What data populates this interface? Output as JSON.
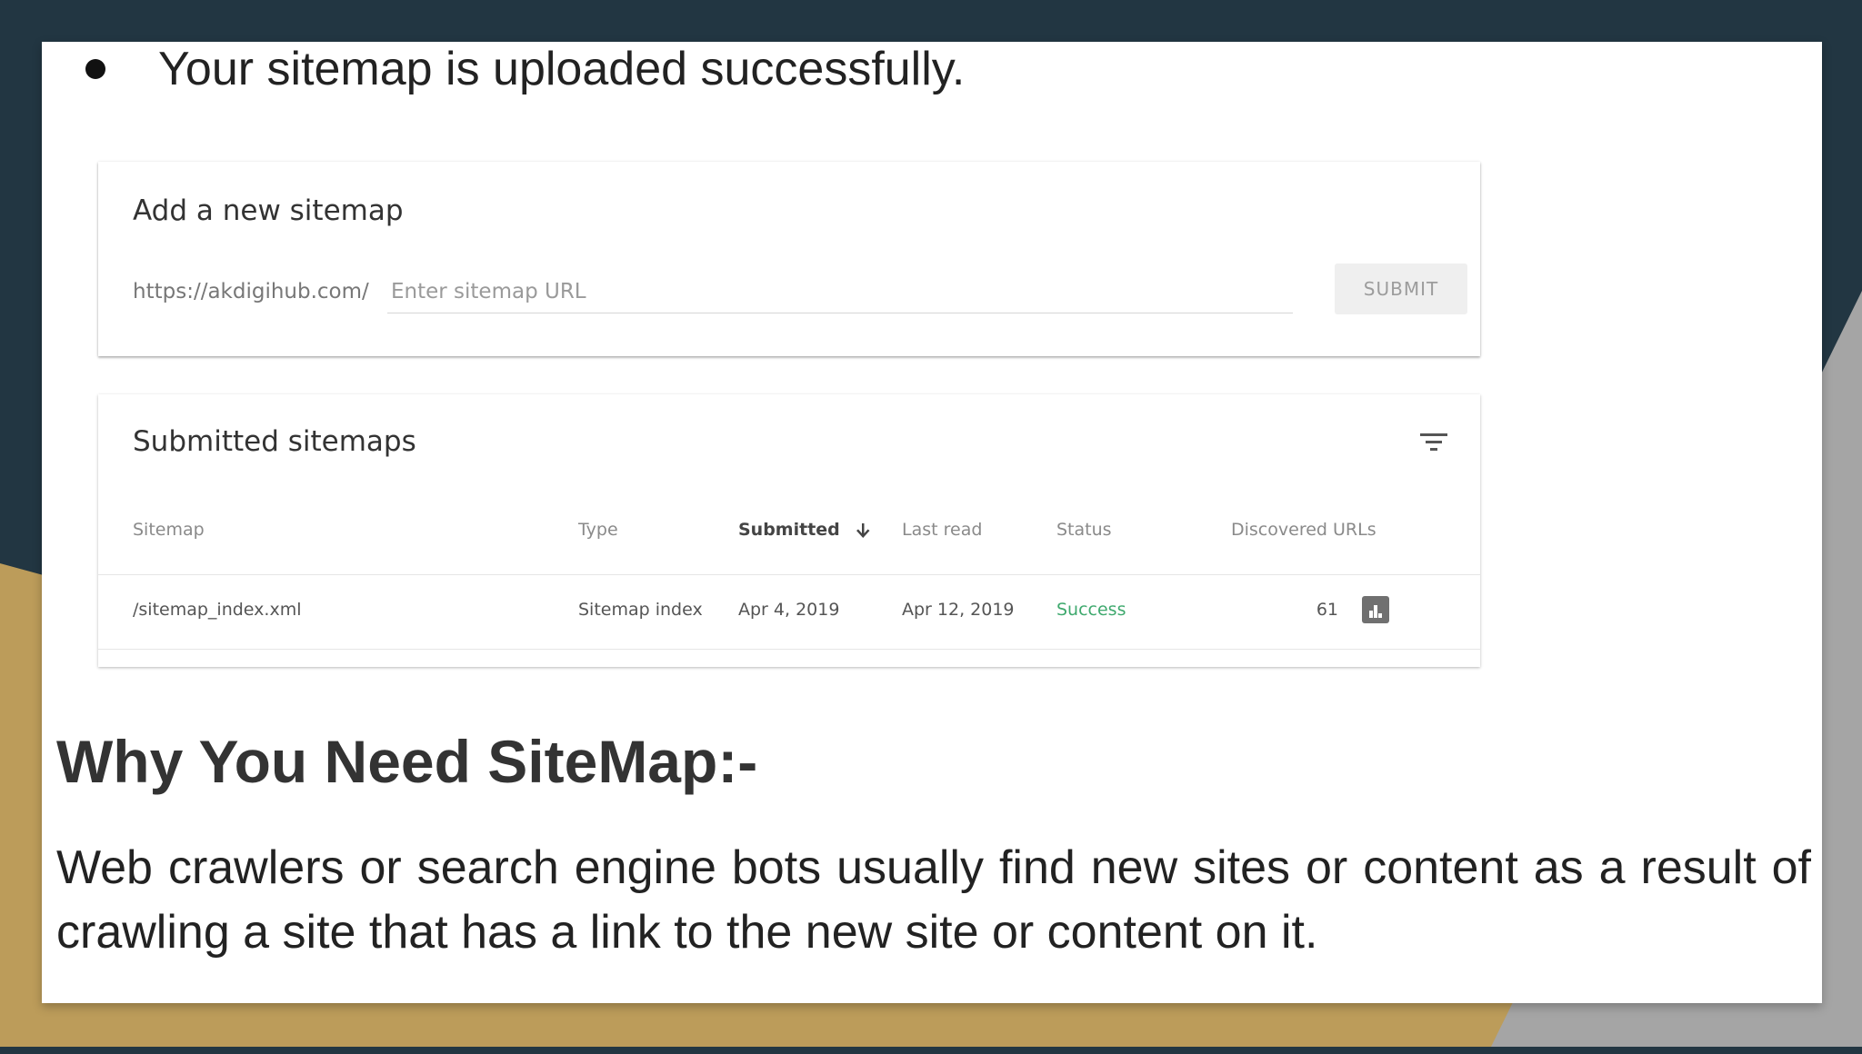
{
  "bullet": {
    "text": "Your sitemap is uploaded successfully."
  },
  "add_sitemap": {
    "title": "Add a new sitemap",
    "url_prefix": "https://akdigihub.com/",
    "input_placeholder": "Enter sitemap URL",
    "submit_label": "SUBMIT"
  },
  "submitted_sitemaps": {
    "title": "Submitted sitemaps",
    "columns": {
      "sitemap": "Sitemap",
      "type": "Type",
      "submitted": "Submitted",
      "last_read": "Last read",
      "status": "Status",
      "discovered_urls": "Discovered URLs"
    },
    "rows": [
      {
        "sitemap": "/sitemap_index.xml",
        "type": "Sitemap index",
        "submitted": "Apr 4, 2019",
        "last_read": "Apr 12, 2019",
        "status": "Success",
        "discovered_urls": "61"
      }
    ],
    "status_color": "#3fa96e"
  },
  "heading": "Why You Need SiteMap:-",
  "paragraph": "Web crawlers or search engine bots usually find new sites or content as a result of crawling a site that has a link to the new site or content on it.",
  "icons": {
    "filter": "filter-icon",
    "sort": "arrow-down-icon",
    "report": "bar-chart-icon"
  },
  "colors": {
    "background_dark": "#223642",
    "background_gold": "#bc9c5a",
    "slide": "#ffffff"
  }
}
